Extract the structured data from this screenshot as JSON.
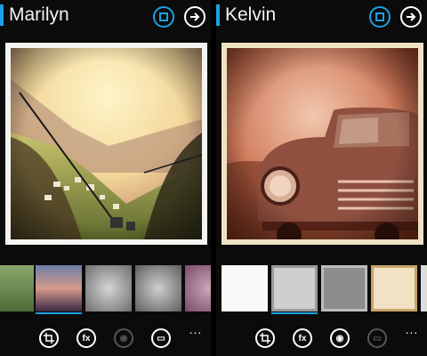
{
  "panels": {
    "left": {
      "title": "Marilyn",
      "accent_color": "#1ba1e2"
    },
    "right": {
      "title": "Kelvin",
      "accent_color": "#1ba1e2"
    }
  },
  "header_icons": [
    "crop-mode-icon",
    "arrow-right-icon"
  ],
  "appbar": {
    "buttons": [
      {
        "name": "crop-icon",
        "glyph": "⌗"
      },
      {
        "name": "effects-icon",
        "glyph": "fx"
      },
      {
        "name": "lightbulb-icon",
        "glyph": "◉"
      },
      {
        "name": "device-icon",
        "glyph": "▭"
      }
    ],
    "more_label": "...",
    "left_disabled": [
      "lightbulb-icon"
    ],
    "right_disabled": [
      "device-icon"
    ]
  },
  "thumbnails": {
    "left": [
      "landscape-swatch",
      "blurred-swatch",
      "gray-swatch",
      "gray-swatch",
      "purple-swatch"
    ],
    "right": [
      "white-swatch",
      "light-gray-swatch",
      "gray-swatch",
      "cream-swatch"
    ]
  },
  "selected_thumbnail": {
    "left": 1,
    "right": 1
  }
}
